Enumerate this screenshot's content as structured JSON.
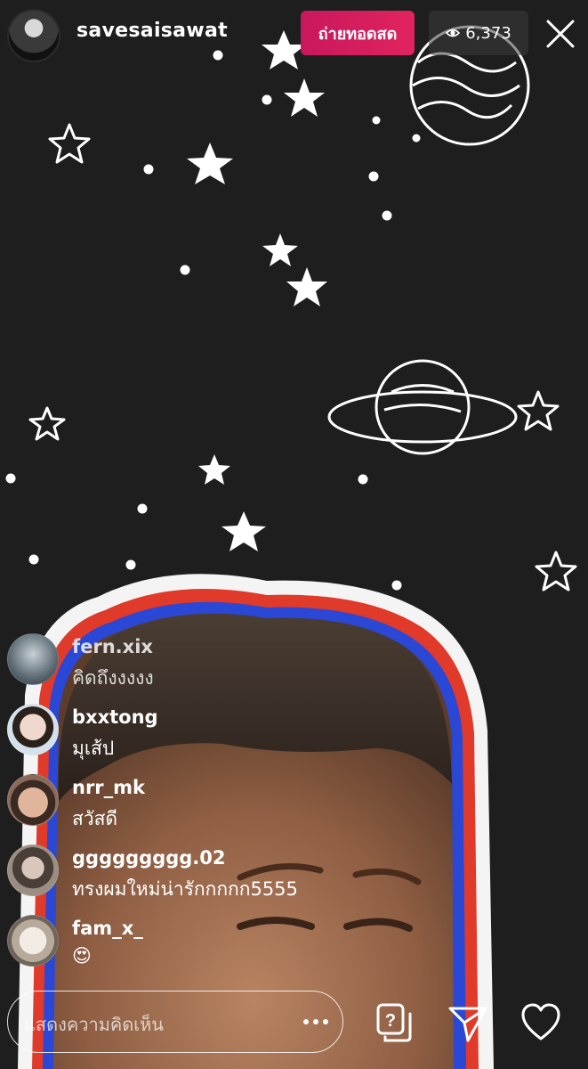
{
  "header": {
    "host_username": "savesaisawat",
    "live_label": "ถ่ายทอดสด",
    "viewer_count": "6,373",
    "colors": {
      "live_badge": "#e0245e",
      "viewer_badge": "#3c3c3c"
    }
  },
  "comments": [
    {
      "username": "fern.xix",
      "text": "คิดถึงงงงง",
      "avatar_color": "#7a8c9a"
    },
    {
      "username": "bxxtong",
      "text": "มุเส้ป",
      "avatar_color": "#d9c2b8"
    },
    {
      "username": "nrr_mk",
      "text": "สวัสดี",
      "avatar_color": "#c9a089"
    },
    {
      "username": "ggggggggg.02",
      "text": "ทรงผมใหม่น่ารักกกกก5555",
      "avatar_color": "#b8a89a"
    },
    {
      "username": "fam_x_",
      "text": "😍",
      "avatar_color": "#d8d0c8"
    }
  ],
  "footer": {
    "comment_placeholder": "แสดงความคิดเห็น",
    "more_icon": "more-dots-icon",
    "qa_icon": "question-stack-icon",
    "send_icon": "paper-plane-icon",
    "like_icon": "heart-icon"
  }
}
